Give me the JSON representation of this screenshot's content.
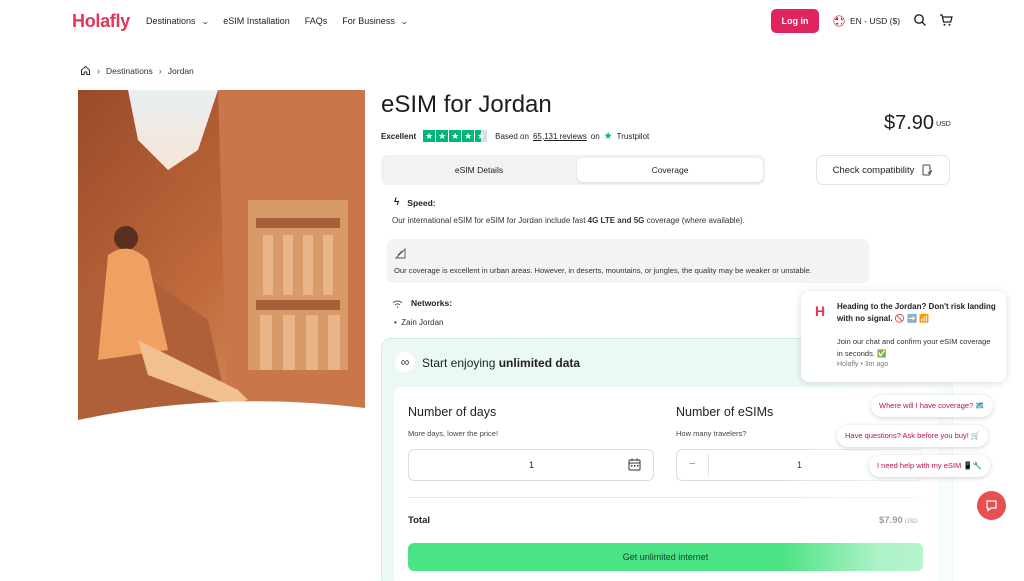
{
  "header": {
    "logo": "Holafly",
    "nav": [
      {
        "label": "Destinations",
        "has_dropdown": true
      },
      {
        "label": "eSIM Installation",
        "has_dropdown": false
      },
      {
        "label": "FAQs",
        "has_dropdown": false
      },
      {
        "label": "For Business",
        "has_dropdown": true
      }
    ],
    "login_label": "Log in",
    "language": "EN - USD ($)",
    "icons": [
      "home-icon",
      "search-icon",
      "cart-icon"
    ]
  },
  "breadcrumb": {
    "items": [
      "Destinations",
      "Jordan"
    ]
  },
  "product": {
    "title": "eSIM for Jordan",
    "rating_label": "Excellent",
    "reviews_prefix": "Based on",
    "reviews_count": "65,131 reviews",
    "reviews_on": "on",
    "trustpilot": "Trustpilot",
    "stars": 4.5,
    "price": "$7.90",
    "currency": "USD"
  },
  "tabs": [
    {
      "label": "eSIM Details",
      "active": false
    },
    {
      "label": "Coverage",
      "active": true
    }
  ],
  "check_compatibility": "Check compatibility",
  "coverage": {
    "speed_title": "Speed:",
    "speed_text_1": "Our international eSIM for eSIM for Jordan include fast ",
    "speed_bold": "4G LTE and 5G",
    "speed_text_2": " coverage (where available).",
    "notice": "Our coverage is excellent in urban areas. However, in deserts, mountains, or jungles, the quality may be weaker or unstable.",
    "networks_title": "Networks:",
    "networks": [
      "Zain Jordan"
    ]
  },
  "plan": {
    "heading_prefix": "Start enjoying ",
    "heading_bold": "unlimited data",
    "days_label": "Number of days",
    "days_hint": "More days, lower the price!",
    "days_value": "1",
    "esims_label": "Number of eSIMs",
    "esims_hint": "How many travelers?",
    "esims_value": "1",
    "minus": "−",
    "total_label": "Total",
    "total_price": "$7.90",
    "total_currency": "USD",
    "cta": "Get unlimited internet"
  },
  "chat": {
    "logo": "H",
    "headline": "Heading to the Jordan? Don't risk landing with no signal. 🚫 ➡️ 📶",
    "body": "Join our chat and confirm your eSIM coverage in seconds. ✅",
    "meta": "Holafly • 3m ago",
    "quick_replies": [
      "Where will I have coverage? 🗺️",
      "Have questions? Ask before you buy! 🛒",
      "I need help with my eSIM 📱🔧"
    ]
  },
  "colors": {
    "brand": "#e6335a",
    "cta": "#4be383",
    "trustpilot": "#00b67a",
    "login": "#e0245e"
  }
}
